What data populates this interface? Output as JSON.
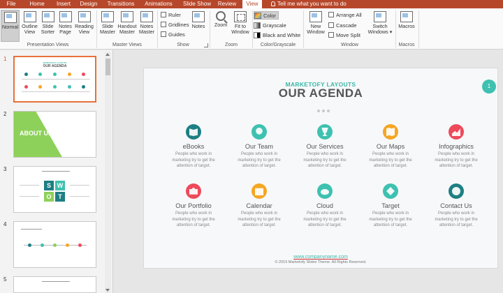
{
  "tabs": [
    "File",
    "Home",
    "Insert",
    "Design",
    "Transitions",
    "Animations",
    "Slide Show",
    "Review",
    "View"
  ],
  "tell_me": "Tell me what you want to do",
  "ribbon": {
    "presentation_views": {
      "label": "Presentation Views",
      "buttons": [
        {
          "line1": "Normal",
          "line2": ""
        },
        {
          "line1": "Outline",
          "line2": "View"
        },
        {
          "line1": "Slide",
          "line2": "Sorter"
        },
        {
          "line1": "Notes",
          "line2": "Page"
        },
        {
          "line1": "Reading",
          "line2": "View"
        }
      ]
    },
    "master_views": {
      "label": "Master Views",
      "buttons": [
        {
          "line1": "Slide",
          "line2": "Master"
        },
        {
          "line1": "Handout",
          "line2": "Master"
        },
        {
          "line1": "Notes",
          "line2": "Master"
        }
      ]
    },
    "show": {
      "label": "Show",
      "checks": [
        "Ruler",
        "Gridlines",
        "Guides"
      ],
      "notes": "Notes"
    },
    "zoom": {
      "label": "Zoom",
      "zoom_btn": "Zoom",
      "fit_line1": "Fit to",
      "fit_line2": "Window"
    },
    "color": {
      "label": "Color/Grayscale",
      "options": [
        "Color",
        "Grayscale",
        "Black and White"
      ]
    },
    "window": {
      "label": "Window",
      "new_line1": "New",
      "new_line2": "Window",
      "arrange": "Arrange All",
      "cascade": "Cascade",
      "move_split": "Move Split",
      "switch_line1": "Switch",
      "switch_line2": "Windows ▾"
    },
    "macros": {
      "label": "Macros",
      "button": "Macros"
    }
  },
  "thumbnails": {
    "numbers": [
      "1",
      "2",
      "3",
      "4",
      "5"
    ],
    "t2_title": "ABOUT US",
    "t3_letters": [
      "S",
      "W",
      "O",
      "T"
    ]
  },
  "slide": {
    "brand": "MARKETOFY LAYOUTS",
    "heading": "OUR AGENDA",
    "number": "1",
    "desc_line1": "People who work in",
    "desc_line2": "marketing try to get the",
    "desc_line3": "attention of target.",
    "items": [
      {
        "title": "eBooks",
        "color": "#1d7f83"
      },
      {
        "title": "Our Team",
        "color": "#3ec1b0"
      },
      {
        "title": "Our Services",
        "color": "#3ec1b0"
      },
      {
        "title": "Our Maps",
        "color": "#f5a623"
      },
      {
        "title": "Infographics",
        "color": "#ee4a5a"
      },
      {
        "title": "Our Portfolio",
        "color": "#ee4a5a"
      },
      {
        "title": "Calendar",
        "color": "#f5a623"
      },
      {
        "title": "Cloud",
        "color": "#3ec1b0"
      },
      {
        "title": "Target",
        "color": "#3ec1b0"
      },
      {
        "title": "Contact Us",
        "color": "#1d7f83"
      }
    ],
    "footer_url": "www.companyname.com",
    "footer_copy": "© 2015 Marketofy Slides Theme. All Rights Reserved."
  },
  "colors": {
    "accent": "#b7472a",
    "teal": "#3ec1b0",
    "active_thumb_border": "#e8703a"
  }
}
